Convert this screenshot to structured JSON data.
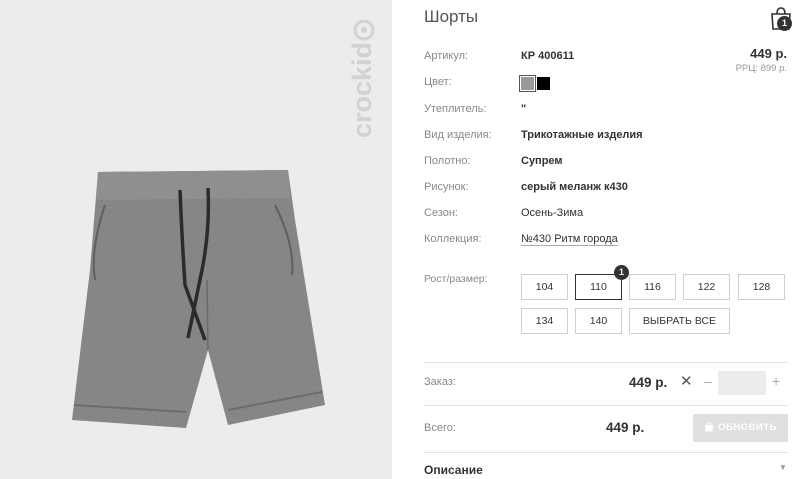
{
  "brand": {
    "logo_text": "crockid"
  },
  "product": {
    "title": "Шорты",
    "price": "449 р.",
    "rrp_label": "РРЦ:",
    "rrp_value": "899 р."
  },
  "cart": {
    "count": "1"
  },
  "attributes": [
    {
      "label": "Артикул:",
      "value": "КР 400611"
    },
    {
      "label": "Цвет:",
      "value": ""
    },
    {
      "label": "Утеплитель:",
      "value": "\""
    },
    {
      "label": "Вид изделия:",
      "value": "Трикотажные изделия"
    },
    {
      "label": "Полотно:",
      "value": "Супрем"
    },
    {
      "label": "Рисунок:",
      "value": "серый меланж к430"
    },
    {
      "label": "Сезон:",
      "value": "Осень-Зима"
    },
    {
      "label": "Коллекция:",
      "value": "№430 Ритм города"
    }
  ],
  "colors": [
    "#9a9a9a",
    "#000000"
  ],
  "sizes": {
    "label": "Рост/размер:",
    "options": [
      "104",
      "110",
      "116",
      "122",
      "128",
      "134",
      "140"
    ],
    "select_all": "ВЫБРАТЬ ВСЕ",
    "selected": "110",
    "selected_count": "1"
  },
  "order": {
    "label": "Заказ:",
    "price": "449 р.",
    "multiply": "✕",
    "minus": "–",
    "plus": "+",
    "quantity": ""
  },
  "total": {
    "label": "Всего:",
    "price": "449 р.",
    "button_label": "ОБНОВИТЬ"
  },
  "description": {
    "label": "Описание"
  }
}
